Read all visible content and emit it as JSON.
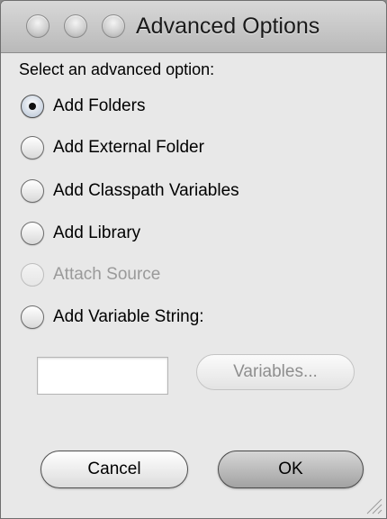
{
  "window": {
    "title": "Advanced Options"
  },
  "prompt": "Select an advanced option:",
  "options": [
    {
      "label": "Add Folders",
      "selected": true,
      "enabled": true
    },
    {
      "label": "Add External Folder",
      "selected": false,
      "enabled": true
    },
    {
      "label": "Add Classpath Variables",
      "selected": false,
      "enabled": true
    },
    {
      "label": "Add Library",
      "selected": false,
      "enabled": true
    },
    {
      "label": "Attach Source",
      "selected": false,
      "enabled": false
    },
    {
      "label": "Add Variable String:",
      "selected": false,
      "enabled": true
    }
  ],
  "variable_input": {
    "value": ""
  },
  "buttons": {
    "variables": "Variables...",
    "cancel": "Cancel",
    "ok": "OK"
  }
}
